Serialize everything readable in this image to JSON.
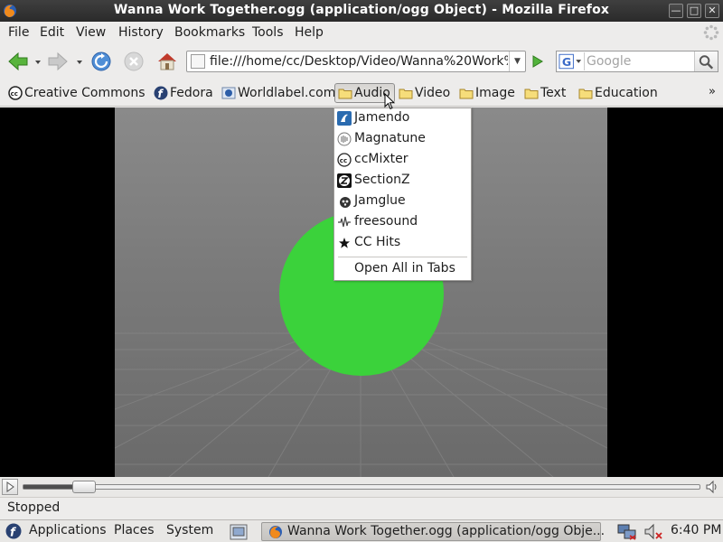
{
  "window": {
    "title": "Wanna Work Together.ogg (application/ogg Object) - Mozilla Firefox",
    "buttons": {
      "minimize": "—",
      "maximize": "□",
      "close": "✕"
    }
  },
  "menubar": [
    "File",
    "Edit",
    "View",
    "History",
    "Bookmarks",
    "Tools",
    "Help"
  ],
  "navbar": {
    "url": "file:///home/cc/Desktop/Video/Wanna%20Work%2",
    "search_placeholder": "Google"
  },
  "bookmarks": [
    {
      "label": "Creative Commons",
      "icon": "creative-commons-icon"
    },
    {
      "label": "Fedora",
      "icon": "fedora-icon"
    },
    {
      "label": "Worldlabel.com",
      "icon": "worldlabel-icon"
    },
    {
      "label": "Audio",
      "icon": "folder-icon"
    },
    {
      "label": "Video",
      "icon": "folder-icon"
    },
    {
      "label": "Image",
      "icon": "folder-icon"
    },
    {
      "label": "Text",
      "icon": "folder-icon"
    },
    {
      "label": "Education",
      "icon": "folder-icon"
    }
  ],
  "chevron": "»",
  "audio_menu": {
    "items": [
      {
        "label": "Jamendo",
        "icon": "jamendo-icon"
      },
      {
        "label": "Magnatune",
        "icon": "magnatune-icon"
      },
      {
        "label": "ccMixter",
        "icon": "ccmixter-icon"
      },
      {
        "label": "SectionZ",
        "icon": "sectionz-icon"
      },
      {
        "label": "Jamglue",
        "icon": "jamglue-icon"
      },
      {
        "label": "freesound",
        "icon": "freesound-icon"
      },
      {
        "label": "CC Hits",
        "icon": "star-icon"
      }
    ],
    "open_all": "Open All in Tabs"
  },
  "player": {
    "progress": 0.09,
    "status": "Stopped"
  },
  "panel": {
    "menus": [
      "Applications",
      "Places",
      "System"
    ],
    "task": "Wanna Work Together.ogg (application/ogg Obje...",
    "clock": "6:40 PM"
  },
  "colors": {
    "ball": "#3bd23b",
    "folder": "#f0d060"
  }
}
